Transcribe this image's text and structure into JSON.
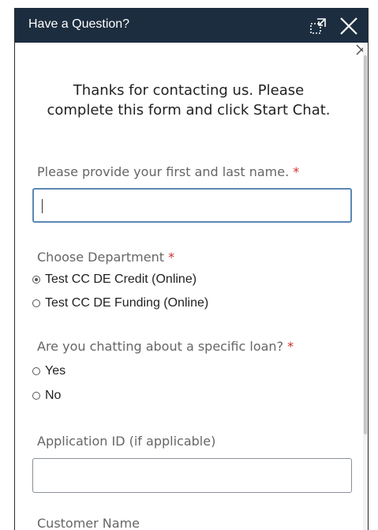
{
  "header": {
    "title": "Have a Question?"
  },
  "intro": "Thanks for contacting us. Please complete this form and click Start Chat.",
  "name_field": {
    "label": "Please provide your first and last name.",
    "required": "*",
    "value": ""
  },
  "department": {
    "label": "Choose Department",
    "required": "*",
    "options": [
      {
        "label": "Test CC DE Credit (Online)",
        "checked": true
      },
      {
        "label": "Test CC DE Funding (Online)",
        "checked": false
      }
    ]
  },
  "loan_question": {
    "label": "Are you chatting about a specific loan?",
    "required": "*",
    "options": [
      {
        "label": "Yes",
        "checked": false
      },
      {
        "label": "No",
        "checked": false
      }
    ]
  },
  "application_id": {
    "label": "Application ID (if applicable)",
    "value": ""
  },
  "customer_name": {
    "label": "Customer Name"
  },
  "colors": {
    "header_bg": "#1c2d3f",
    "required": "#d02d2d",
    "focus_border": "#5a87b4"
  }
}
